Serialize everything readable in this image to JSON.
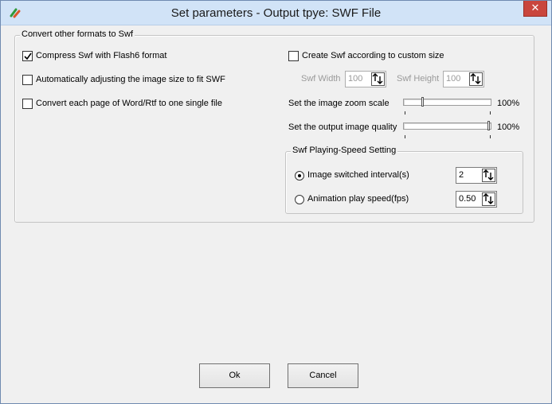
{
  "window": {
    "title": "Set parameters - Output tpye: SWF File",
    "close_glyph": "✕"
  },
  "main_group": {
    "legend": "Convert other formats to Swf",
    "compress_label": "Compress Swf with Flash6 format",
    "compress_checked": true,
    "auto_adjust_label": "Automatically adjusting the image size to fit SWF",
    "auto_adjust_checked": false,
    "convert_each_page_label": "Convert each page of Word/Rtf to one single file",
    "convert_each_page_checked": false,
    "custom_size_label": "Create Swf according to custom size",
    "custom_size_checked": false,
    "swf_width_label": "Swf Width",
    "swf_width_value": "100",
    "swf_height_label": "Swf Height",
    "swf_height_value": "100",
    "zoom_label": "Set the image zoom scale",
    "zoom_value": "100%",
    "zoom_level": 0.22,
    "quality_label": "Set the output image quality",
    "quality_value": "100%",
    "quality_level": 1.0
  },
  "speed_group": {
    "legend": "Swf Playing-Speed Setting",
    "interval_label": "Image switched interval(s)",
    "interval_value": "2",
    "interval_selected": true,
    "fps_label": "Animation play speed(fps)",
    "fps_value": "0.50",
    "fps_selected": false
  },
  "buttons": {
    "ok_label": "Ok",
    "cancel_label": "Cancel"
  },
  "icons": {
    "app": "app-icon",
    "spin": "spin-arrows-icon",
    "check": "checkmark-icon"
  }
}
